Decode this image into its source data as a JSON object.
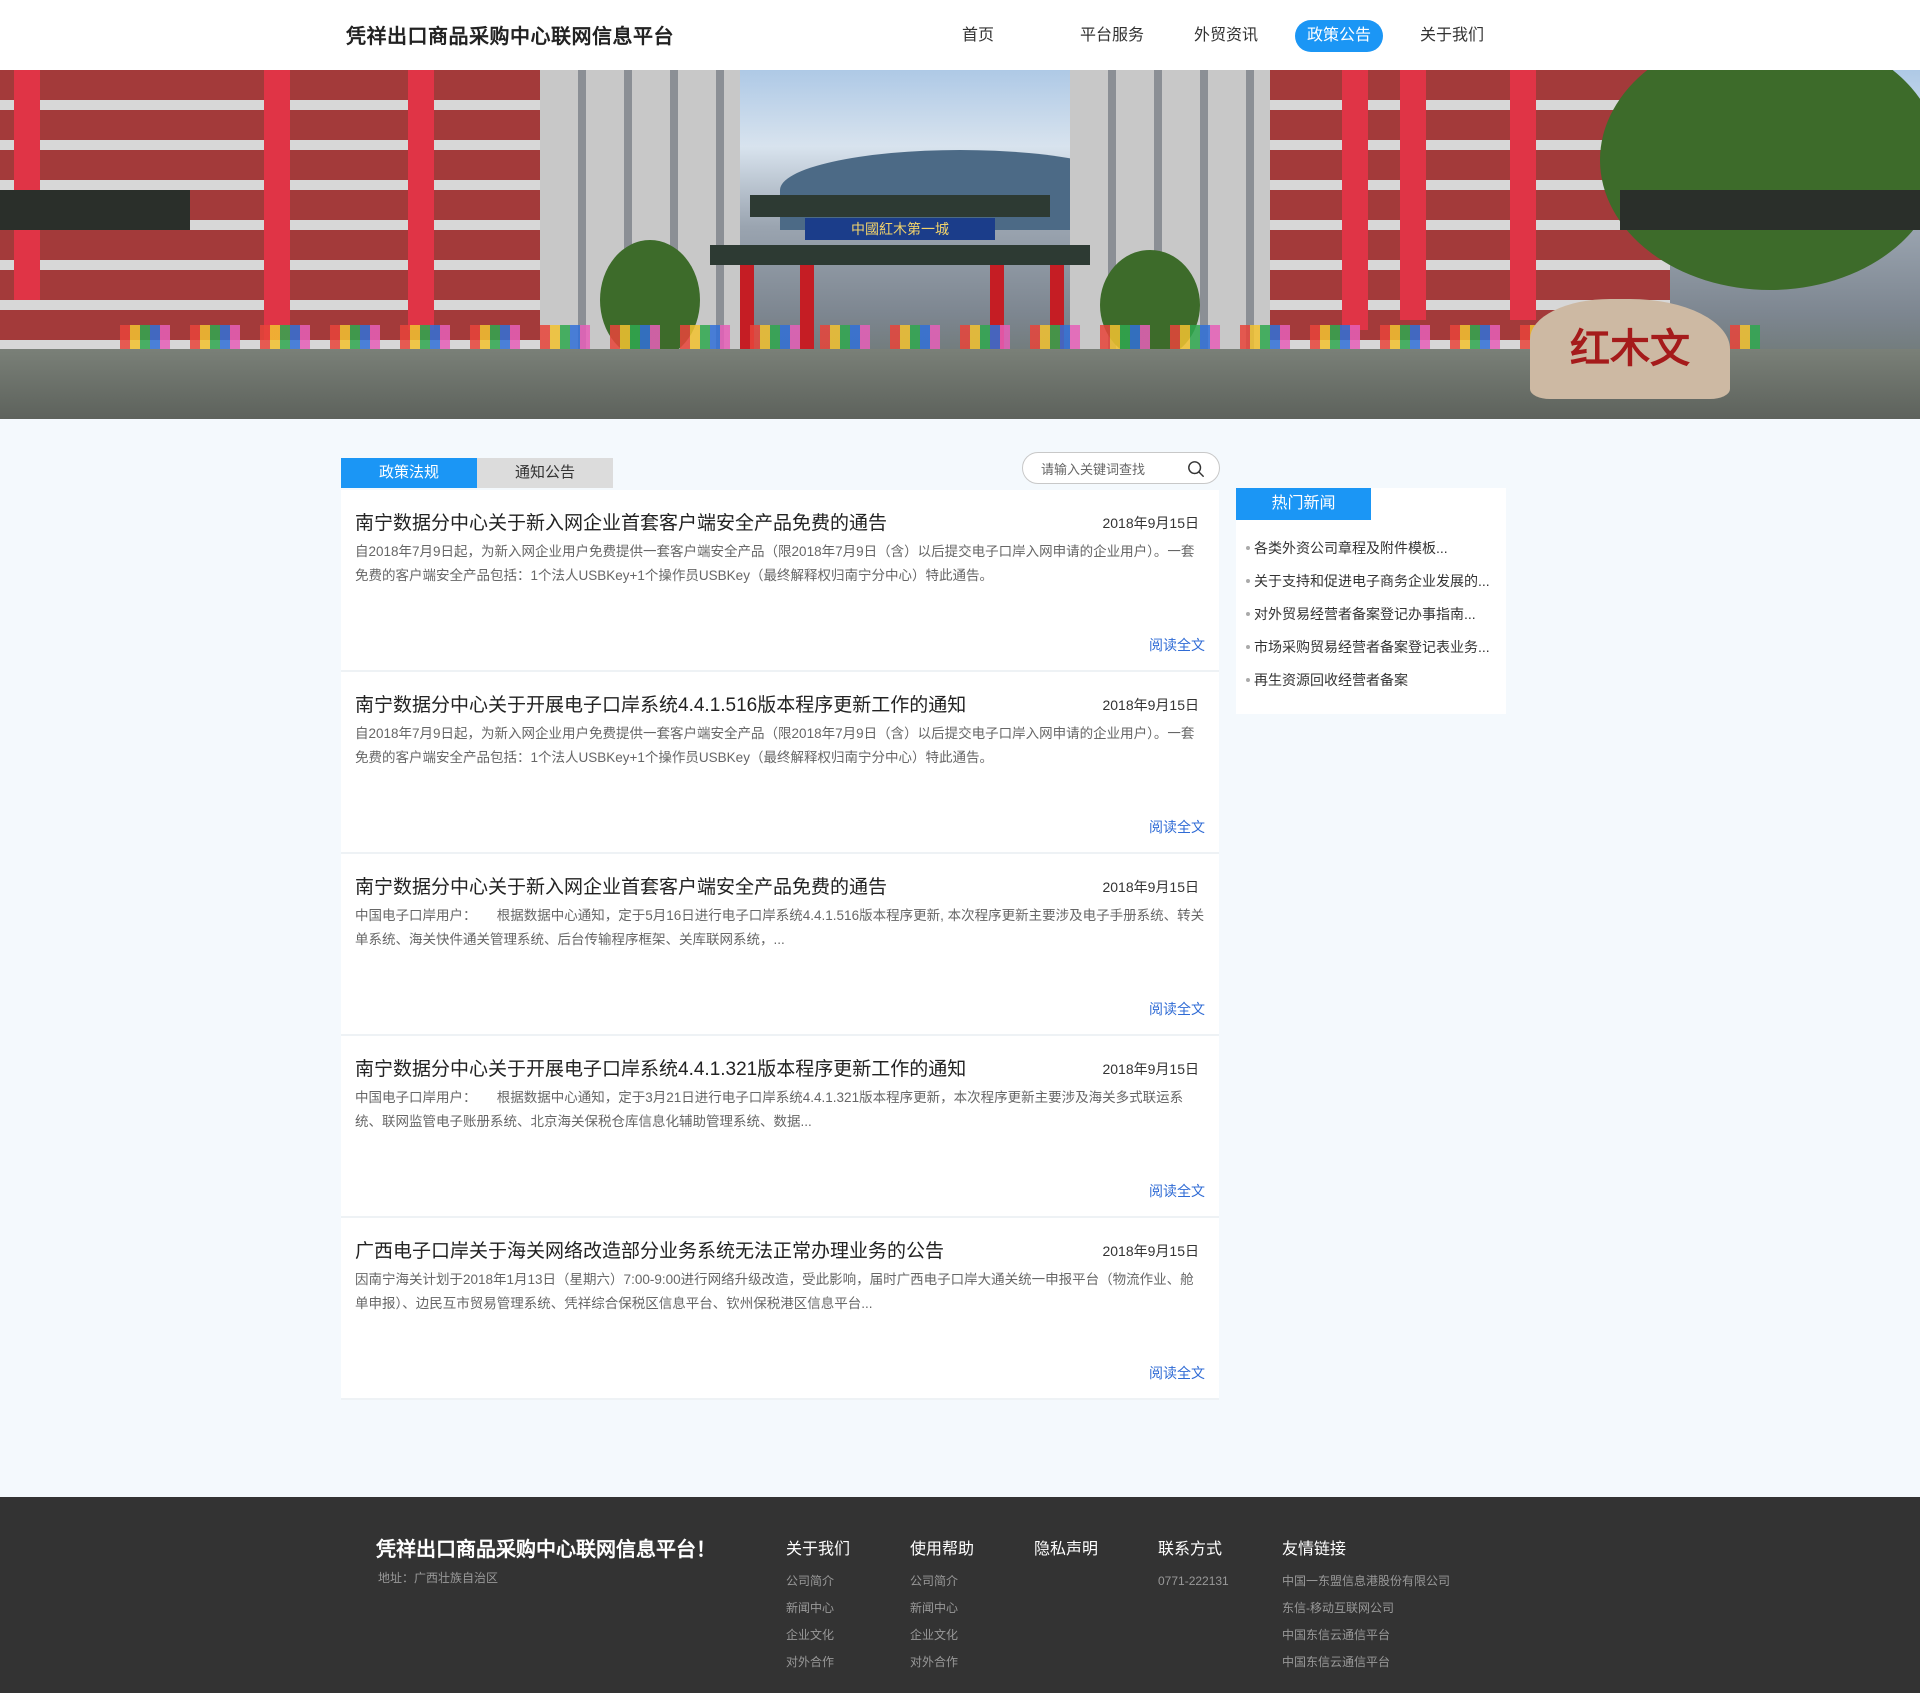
{
  "header": {
    "site_title": "凭祥出口商品采购中心联网信息平台",
    "nav": [
      {
        "label": "首页"
      },
      {
        "label": "平台服务"
      },
      {
        "label": "外贸资讯"
      },
      {
        "label": "政策公告",
        "active": true
      },
      {
        "label": "关于我们"
      }
    ]
  },
  "banner": {
    "gate_sign": "中國紅木第一城",
    "stone_text": "红木文"
  },
  "tabs": {
    "policy": "政策法规",
    "notice": "通知公告",
    "active": "policy"
  },
  "search": {
    "placeholder": "请输入关键词查找",
    "value": ""
  },
  "articles": [
    {
      "title": "南宁数据分中心关于新入网企业首套客户端安全产品免费的通告",
      "date": "2018年9月15日",
      "summary": "自2018年7月9日起，为新入网企业用户免费提供一套客户端安全产品（限2018年7月9日（含）以后提交电子口岸入网申请的企业用户）。一套免费的客户端安全产品包括：1个法人USBKey+1个操作员USBKey（最终解释权归南宁分中心）特此通告。",
      "more": "阅读全文"
    },
    {
      "title": "南宁数据分中心关于开展电子口岸系统4.4.1.516版本程序更新工作的通知",
      "date": "2018年9月15日",
      "summary": "自2018年7月9日起，为新入网企业用户免费提供一套客户端安全产品（限2018年7月9日（含）以后提交电子口岸入网申请的企业用户）。一套免费的客户端安全产品包括：1个法人USBKey+1个操作员USBKey（最终解释权归南宁分中心）特此通告。",
      "more": "阅读全文"
    },
    {
      "title": "南宁数据分中心关于新入网企业首套客户端安全产品免费的通告",
      "date": "2018年9月15日",
      "summary": "中国电子口岸用户：　　根据数据中心通知，定于5月16日进行电子口岸系统4.4.1.516版本程序更新, 本次程序更新主要涉及电子手册系统、转关单系统、海关快件通关管理系统、后台传输程序框架、关库联网系统，...",
      "more": "阅读全文"
    },
    {
      "title": "南宁数据分中心关于开展电子口岸系统4.4.1.321版本程序更新工作的通知",
      "date": "2018年9月15日",
      "summary": "中国电子口岸用户：　　根据数据中心通知，定于3月21日进行电子口岸系统4.4.1.321版本程序更新，本次程序更新主要涉及海关多式联运系统、联网监管电子账册系统、北京海关保税仓库信息化辅助管理系统、数据...",
      "more": "阅读全文"
    },
    {
      "title": "广西电子口岸关于海关网络改造部分业务系统无法正常办理业务的公告",
      "date": "2018年9月15日",
      "summary": "因南宁海关计划于2018年1月13日（星期六）7:00-9:00进行网络升级改造，受此影响，届时广西电子口岸大通关统一申报平台（物流作业、舱单申报）、边民互市贸易管理系统、凭祥综合保税区信息平台、钦州保税港区信息平台...",
      "more": "阅读全文"
    }
  ],
  "hot_news": {
    "title": "热门新闻",
    "items": [
      "各类外资公司章程及附件模板...",
      "关于支持和促进电子商务企业发展的...",
      "对外贸易经营者备案登记办事指南...",
      "市场采购贸易经营者备案登记表业务...",
      "再生资源回收经营者备案"
    ]
  },
  "footer": {
    "title": "凭祥出口商品采购中心联网信息平台！",
    "address": "地址：广西壮族自治区",
    "columns": [
      {
        "heading": "关于我们",
        "links": [
          "公司简介",
          "新闻中心",
          "企业文化",
          "对外合作"
        ]
      },
      {
        "heading": "使用帮助",
        "links": [
          "公司简介",
          "新闻中心",
          "企业文化",
          "对外合作"
        ]
      },
      {
        "heading": "隐私声明",
        "links": []
      },
      {
        "heading": "联系方式",
        "links": [
          "0771-222131"
        ]
      },
      {
        "heading": "友情链接",
        "links": [
          "中国一东盟信息港股份有限公司",
          "东信-移动互联网公司",
          "中国东信云通信平台",
          "中国东信云通信平台"
        ]
      }
    ]
  },
  "colors": {
    "accent": "#1b96f5",
    "link": "#2f6bd5",
    "footer_bg": "#333333",
    "page_bg": "#f4f9fd"
  }
}
